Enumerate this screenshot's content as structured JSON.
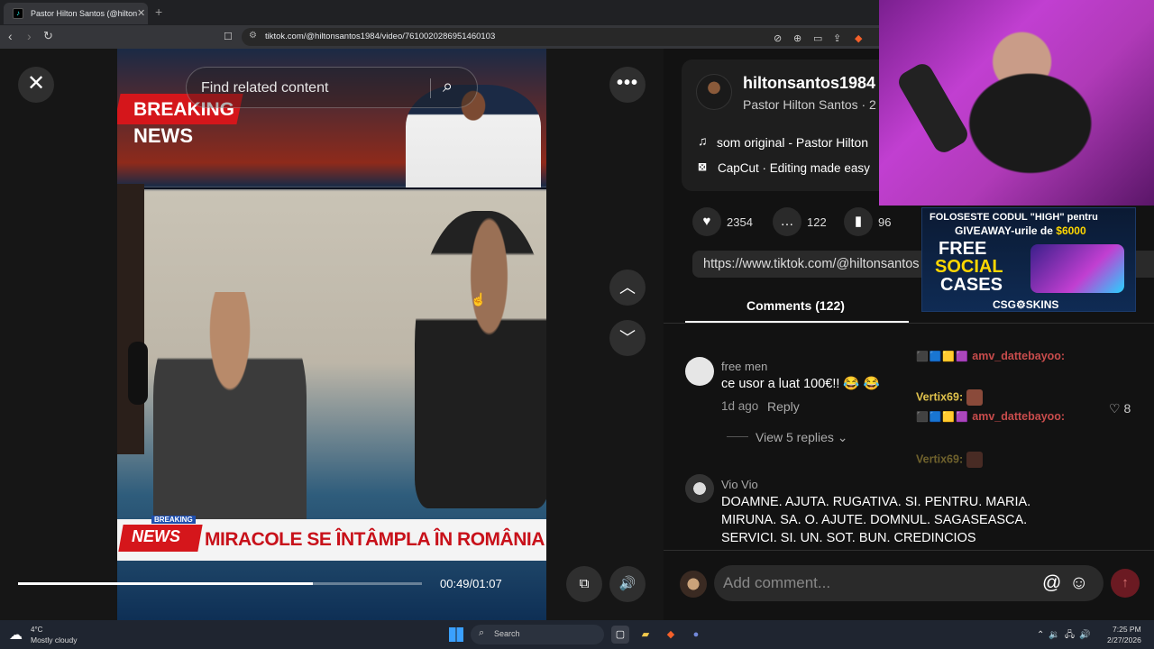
{
  "browser": {
    "tab_title": "Pastor Hilton Santos (@hilton",
    "tab_close": "✕",
    "new_tab": "+",
    "url": "tiktok.com/@hiltonsantos1984/video/7610020286951460103"
  },
  "video": {
    "search_placeholder": "Find related content",
    "breaking": "BREAKING",
    "news": "NEWS",
    "lower_breaking": "BREAKING",
    "lower_news": "NEWS",
    "headline": "MIRACOLE SE ÎNTÂMPLA ÎN ROMÂNIA",
    "time": "00:49/01:07",
    "progress": 0.73
  },
  "post": {
    "username": "hiltonsantos1984",
    "display_name": "Pastor Hilton Santos · 2",
    "music": "som original - Pastor Hilton",
    "capcut": "CapCut · Editing made easy",
    "likes": "2354",
    "comments": "122",
    "saves": "96",
    "link": "https://www.tiktok.com/@hiltonsantos"
  },
  "comments_tab": "Comments (122)",
  "comments": [
    {
      "name": "free men",
      "text": "ce usor a luat 100€!! 😂 😂",
      "time": "1d ago",
      "reply": "Reply",
      "likes": "8",
      "view_replies": "View 5 replies"
    },
    {
      "name": "Vio Vio",
      "lines": [
        "DOAMNE. AJUTA. RUGATIVA. SI. PENTRU. MARIA.",
        "MIRUNA. SA. O. AJUTE. DOMNUL. SAGASEASCA.",
        "SERVICI. SI. UN. SOT. BUN. CREDINCIOS"
      ]
    }
  ],
  "comment_input_placeholder": "Add comment...",
  "stream_overlay": {
    "ad_line1": "FOLOSESTE CODUL \"HIGH\" pentru",
    "ad_line2_prefix": "GIVEAWAY-urile de ",
    "ad_amount": "$6000",
    "ad_free": "FREE",
    "ad_social": "SOCIAL",
    "ad_cases": "CASES",
    "ad_brand": "CSG⚙SKINS",
    "chat": [
      {
        "user": "amv_dattebayoo:",
        "type": "user"
      },
      {
        "user": "Vertix69:",
        "type": "user2"
      },
      {
        "user": "amv_dattebayoo:",
        "type": "user"
      },
      {
        "user": "Vertix69:",
        "type": "user2"
      }
    ]
  },
  "taskbar": {
    "temp": "4°C",
    "weather": "Mostly cloudy",
    "search": "Search",
    "time": "7:25 PM",
    "date": "2/27/2026"
  },
  "colors": {
    "accent_red": "#fe2c55",
    "breaking_red": "#d5161b",
    "background": "#121212"
  }
}
